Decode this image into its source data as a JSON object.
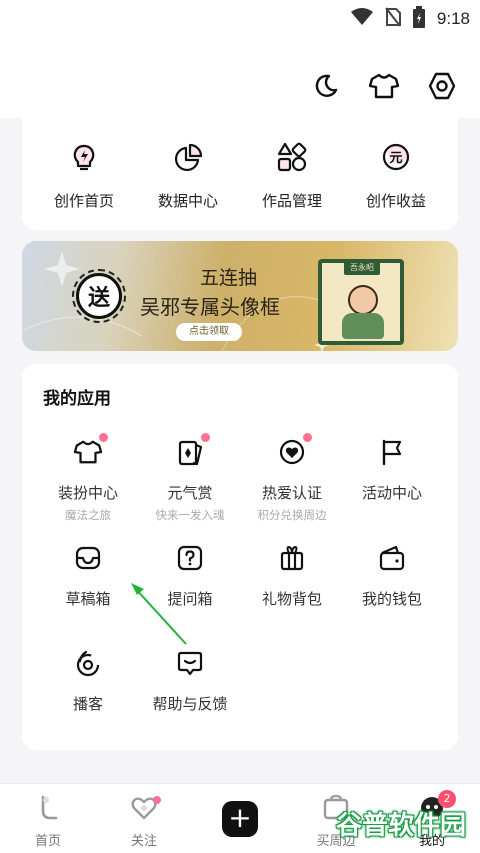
{
  "status_bar": {
    "time": "9:18",
    "icons": [
      "wifi-icon",
      "no-sim-icon",
      "battery-icon"
    ]
  },
  "toolbar": {
    "icons": [
      "moon-icon",
      "tshirt-icon",
      "settings-hex-icon"
    ]
  },
  "creator_tools": [
    {
      "label": "创作首页",
      "icon": "bulb-lightning-icon"
    },
    {
      "label": "数据中心",
      "icon": "pie-chart-icon"
    },
    {
      "label": "作品管理",
      "icon": "shapes-icon"
    },
    {
      "label": "创作收益",
      "icon": "yuan-coin-icon"
    }
  ],
  "banner": {
    "badge": "送",
    "line1": "五连抽",
    "line2": "吴邪专属头像框",
    "button": "点击领取",
    "frame_tag": "吾永昭"
  },
  "my_apps": {
    "title": "我的应用",
    "items": [
      {
        "label": "装扮中心",
        "sub": "魔法之旅",
        "icon": "tshirt-icon",
        "dot": true
      },
      {
        "label": "元气赏",
        "sub": "快来一发入魂",
        "icon": "cards-icon",
        "dot": true
      },
      {
        "label": "热爱认证",
        "sub": "积分兑换周边",
        "icon": "heart-badge-icon",
        "dot": true
      },
      {
        "label": "活动中心",
        "sub": "",
        "icon": "flag-icon",
        "dot": false
      },
      {
        "label": "草稿箱",
        "sub": "",
        "icon": "inbox-icon",
        "dot": false
      },
      {
        "label": "提问箱",
        "sub": "",
        "icon": "question-box-icon",
        "dot": false
      },
      {
        "label": "礼物背包",
        "sub": "",
        "icon": "gift-icon",
        "dot": false
      },
      {
        "label": "我的钱包",
        "sub": "",
        "icon": "wallet-icon",
        "dot": false
      },
      {
        "label": "播客",
        "sub": "",
        "icon": "podcast-icon",
        "dot": false
      },
      {
        "label": "帮助与反馈",
        "sub": "",
        "icon": "feedback-icon",
        "dot": false
      }
    ]
  },
  "bottom_nav": {
    "items": [
      {
        "label": "首页",
        "icon": "home-icon"
      },
      {
        "label": "关注",
        "icon": "follow-heart-icon",
        "dot": true
      },
      {
        "label": "",
        "icon": "plus-icon"
      },
      {
        "label": "买周边",
        "icon": "shop-icon"
      },
      {
        "label": "我的",
        "icon": "profile-icon",
        "badge": "2"
      }
    ]
  },
  "watermark": {
    "text": "谷普软件园"
  },
  "colors": {
    "accent_dot": "#ff6f8f",
    "annotation_arrow": "#22b33a"
  }
}
